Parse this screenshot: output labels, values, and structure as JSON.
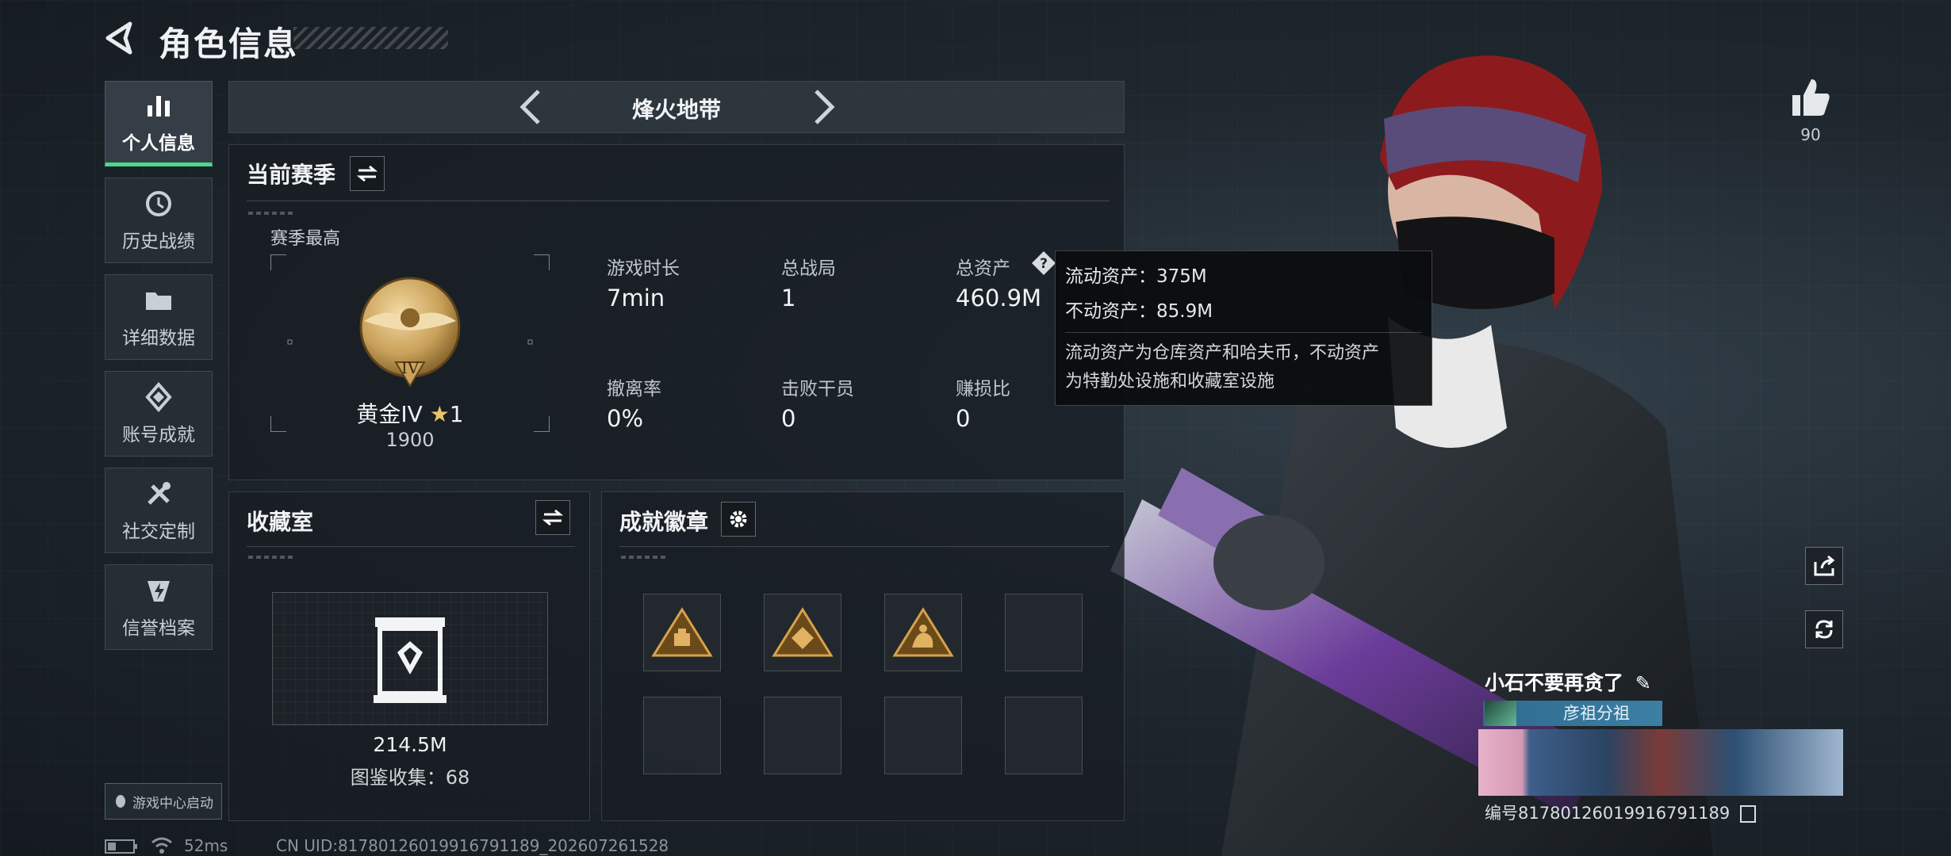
{
  "header": {
    "title": "角色信息"
  },
  "sidebar": {
    "items": [
      {
        "label": "个人信息",
        "active": true
      },
      {
        "label": "历史战绩"
      },
      {
        "label": "详细数据"
      },
      {
        "label": "账号成就"
      },
      {
        "label": "社交定制"
      },
      {
        "label": "信誉档案"
      }
    ],
    "launch_label": "游戏中心启动"
  },
  "mode": {
    "title": "烽火地带"
  },
  "season": {
    "title": "当前赛季",
    "best_label": "赛季最高",
    "rank_name": "黄金IV",
    "rank_stars": "1",
    "rank_score": "1900",
    "rank_emblem_text": "IV",
    "stats": [
      {
        "label": "游戏时长",
        "value": "7min"
      },
      {
        "label": "总战局",
        "value": "1"
      },
      {
        "label": "总资产",
        "value": "460.9M"
      },
      {
        "label": "撤离率",
        "value": "0%"
      },
      {
        "label": "击败干员",
        "value": "0"
      },
      {
        "label": "赚损比",
        "value": "0"
      }
    ]
  },
  "tooltip": {
    "liquid": "流动资产：375M",
    "fixed": "不动资产：85.9M",
    "desc_line1": "流动资产为仓库资产和哈夫币，不动资产",
    "desc_line2": "为特勤处设施和收藏室设施"
  },
  "collection": {
    "title": "收藏室",
    "value": "214.5M",
    "catalog": "图鉴收集：68"
  },
  "achievements": {
    "title": "成就徽章",
    "badges_filled": 3,
    "slots": 8
  },
  "status_bar": {
    "ping": "52ms",
    "uid": "CN UID:81780126019916791189_202607261528"
  },
  "profile": {
    "likes": "90",
    "name": "小石不要再贪了",
    "guild": "彦祖分祖",
    "uid": "编号81780126019916791189"
  },
  "colors": {
    "accent_green": "#49d98a",
    "gold": "#c9a15a",
    "guild_blue": "#3c7fa5"
  }
}
